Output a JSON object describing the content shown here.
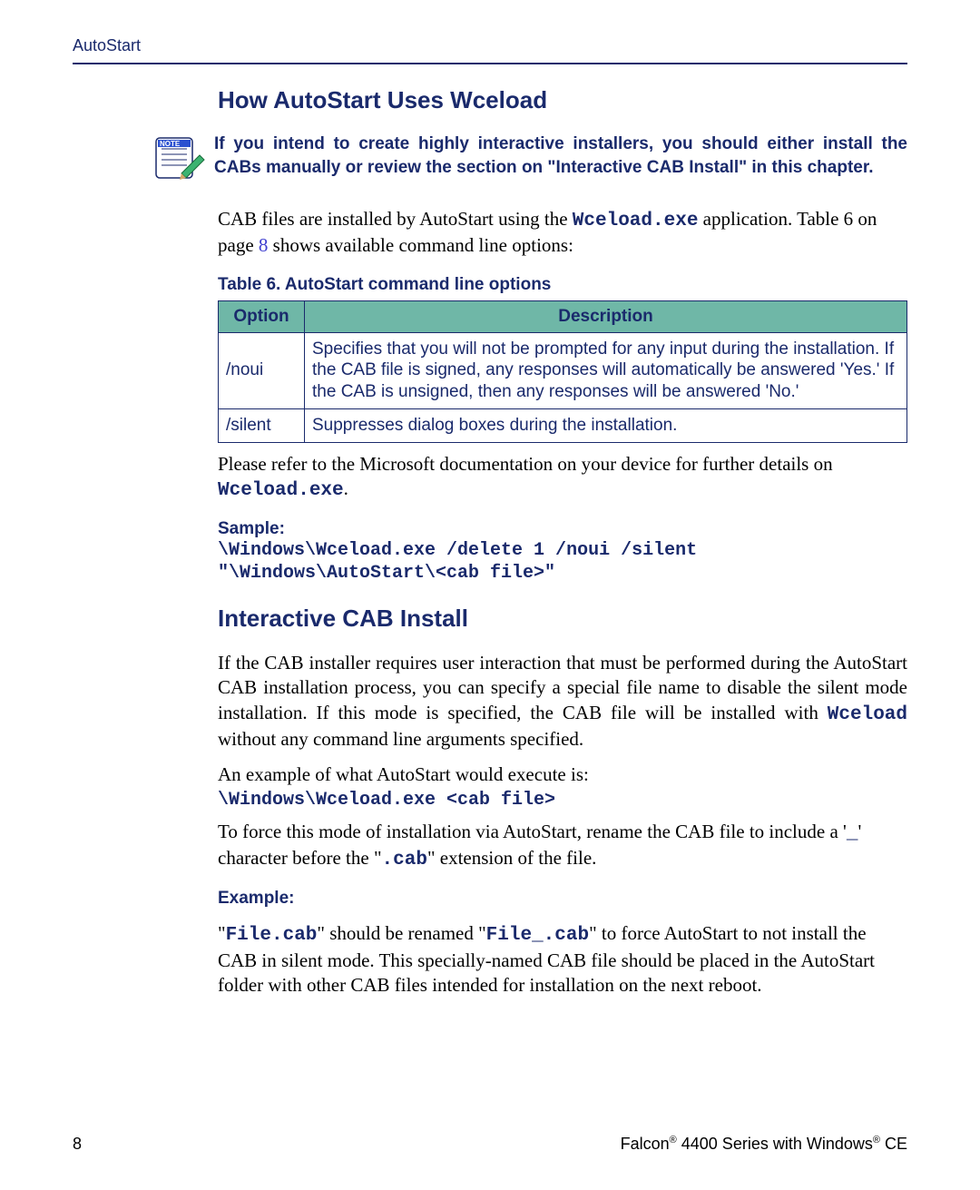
{
  "header": {
    "section": "AutoStart"
  },
  "h_wceload": "How AutoStart Uses Wceload",
  "note": "If you intend to create highly interactive installers, you should either install the CABs manually or review the section on \"Interactive CAB Install\" in this chapter.",
  "p_cab1_a": "CAB files are installed by AutoStart using the ",
  "p_cab1_code": "Wceload.exe",
  "p_cab1_b": " application. Table 6 on page ",
  "p_cab1_link": "8",
  "p_cab1_c": " shows available command line options:",
  "table_caption": "Table 6. AutoStart command line options",
  "table": {
    "headers": {
      "option": "Option",
      "description": "Description"
    },
    "rows": [
      {
        "option": "/noui",
        "description": "Specifies that you will not be prompted for any input during the installation. If the CAB file is signed, any responses will automatically be answered 'Yes.' If the CAB is unsigned, then any responses will be answered 'No.'"
      },
      {
        "option": "/silent",
        "description": "Suppresses dialog boxes during the installation."
      }
    ]
  },
  "p_refer_a": "Please refer to the Microsoft documentation on your device for further details on ",
  "p_refer_code": "Wceload.exe",
  "p_refer_b": ".",
  "sample_label": "Sample:",
  "sample_code": "\\Windows\\Wceload.exe /delete 1 /noui /silent \"\\Windows\\AutoStart\\<cab file>\"",
  "h_interactive": "Interactive CAB Install",
  "p_int1_a": "If the CAB installer requires user interaction that must be performed during the AutoStart CAB installation process, you can specify a special file name to disable the silent mode installation. If this mode is specified, the CAB file will be installed with ",
  "p_int1_code": "Wceload",
  "p_int1_b": " without any command line arguments specified.",
  "p_int2": "An example of what AutoStart would execute is:",
  "int_code": "\\Windows\\Wceload.exe <cab file>",
  "p_int3_a": "To force this mode of installation via AutoStart, rename the CAB file to include a '",
  "p_int3_code1": "_",
  "p_int3_b": "' character before the \"",
  "p_int3_code2": ".cab",
  "p_int3_c": "\" extension of the file.",
  "example_label": "Example:",
  "p_ex_a": "\"",
  "p_ex_code1": "File.cab",
  "p_ex_b": "\" should be renamed \"",
  "p_ex_code2": "File_.cab",
  "p_ex_c": "\" to force AutoStart to not install the CAB in silent mode. This specially-named CAB file should be placed in the AutoStart folder with other CAB files intended for installation on the next reboot.",
  "footer": {
    "page": "8",
    "product_a": "Falcon",
    "product_b": " 4400 Series with Windows",
    "product_c": " CE",
    "reg": "®"
  }
}
